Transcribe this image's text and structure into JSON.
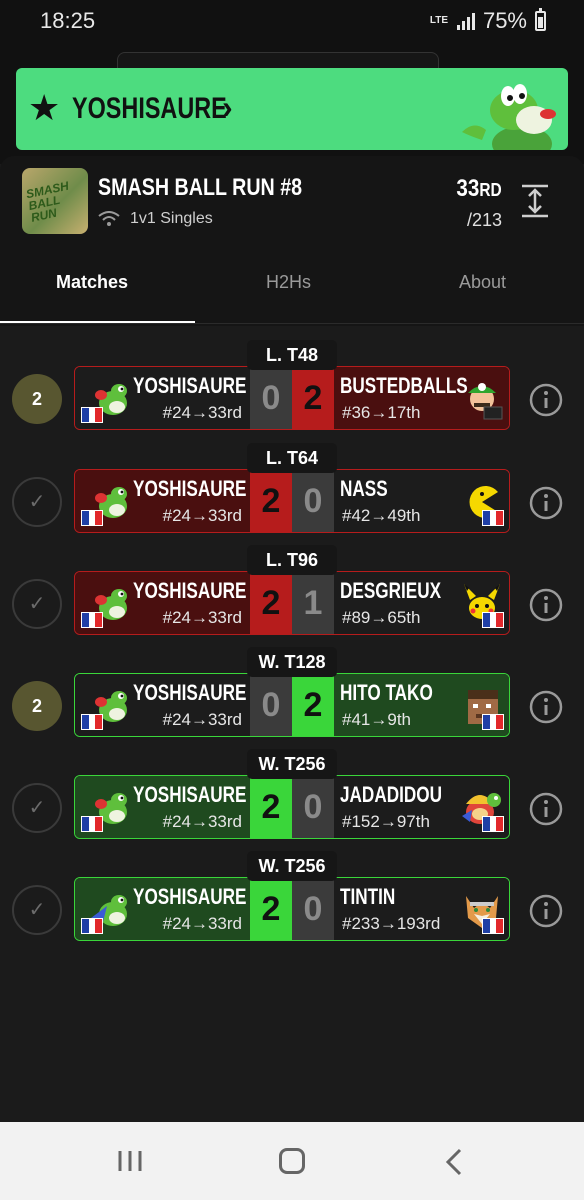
{
  "status_bar": {
    "time": "18:25",
    "network": "LTE",
    "battery": "75%"
  },
  "player": {
    "name": "YOSHISAURE",
    "star_icon": "star-icon",
    "chevron": "›"
  },
  "tournament": {
    "name": "SMASH BALL RUN #8",
    "logo_text": "SMASH BALL RUN",
    "format": "1v1 Singles",
    "placement": "33",
    "placement_suffix": "RD",
    "total": "/213"
  },
  "tabs": [
    {
      "label": "Matches",
      "active": true
    },
    {
      "label": "H2Hs",
      "active": false
    },
    {
      "label": "About",
      "active": false
    }
  ],
  "matches": [
    {
      "round": "L. T48",
      "status": "2",
      "status_type": "number",
      "result": "loss",
      "left": {
        "name": "YOSHISAURE",
        "seed": "#24→33rd",
        "score": "0",
        "character": "yoshi"
      },
      "right": {
        "name": "BUSTEDBALLS",
        "seed": "#36→17th",
        "score": "2",
        "character": "luigi"
      }
    },
    {
      "round": "L. T64",
      "status": "✓",
      "status_type": "done",
      "result": "win",
      "left": {
        "name": "YOSHISAURE",
        "seed": "#24→33rd",
        "score": "2",
        "character": "yoshi"
      },
      "right": {
        "name": "NASS",
        "seed": "#42→49th",
        "score": "0",
        "character": "pacman"
      }
    },
    {
      "round": "L. T96",
      "status": "✓",
      "status_type": "done",
      "result": "win",
      "left": {
        "name": "YOSHISAURE",
        "seed": "#24→33rd",
        "score": "2",
        "character": "yoshi"
      },
      "right": {
        "name": "DESGRIEUX",
        "seed": "#89→65th",
        "score": "1",
        "character": "pikachu"
      }
    },
    {
      "round": "W. T128",
      "status": "2",
      "status_type": "number",
      "result": "loss",
      "left": {
        "name": "YOSHISAURE",
        "seed": "#24→33rd",
        "score": "0",
        "character": "yoshi"
      },
      "right": {
        "name": "HITO TAKO",
        "seed": "#41→9th",
        "score": "2",
        "character": "steve"
      }
    },
    {
      "round": "W. T256",
      "status": "✓",
      "status_type": "done",
      "result": "win",
      "left": {
        "name": "YOSHISAURE",
        "seed": "#24→33rd",
        "score": "2",
        "character": "yoshi"
      },
      "right": {
        "name": "JADADIDOU",
        "seed": "#152→97th",
        "score": "0",
        "character": "king-dedede"
      }
    },
    {
      "round": "W. T256",
      "status": "✓",
      "status_type": "done",
      "result": "win",
      "left": {
        "name": "YOSHISAURE",
        "seed": "#24→33rd",
        "score": "2",
        "character": "yoshi-blue"
      },
      "right": {
        "name": "TINTIN",
        "seed": "#233→193rd",
        "score": "0",
        "character": "fox"
      }
    }
  ],
  "colors": {
    "banner_green": "#4ddc7f",
    "loss_red": "#b61c1c",
    "win_green": "#3ad63a",
    "status_olive": "#585630"
  }
}
